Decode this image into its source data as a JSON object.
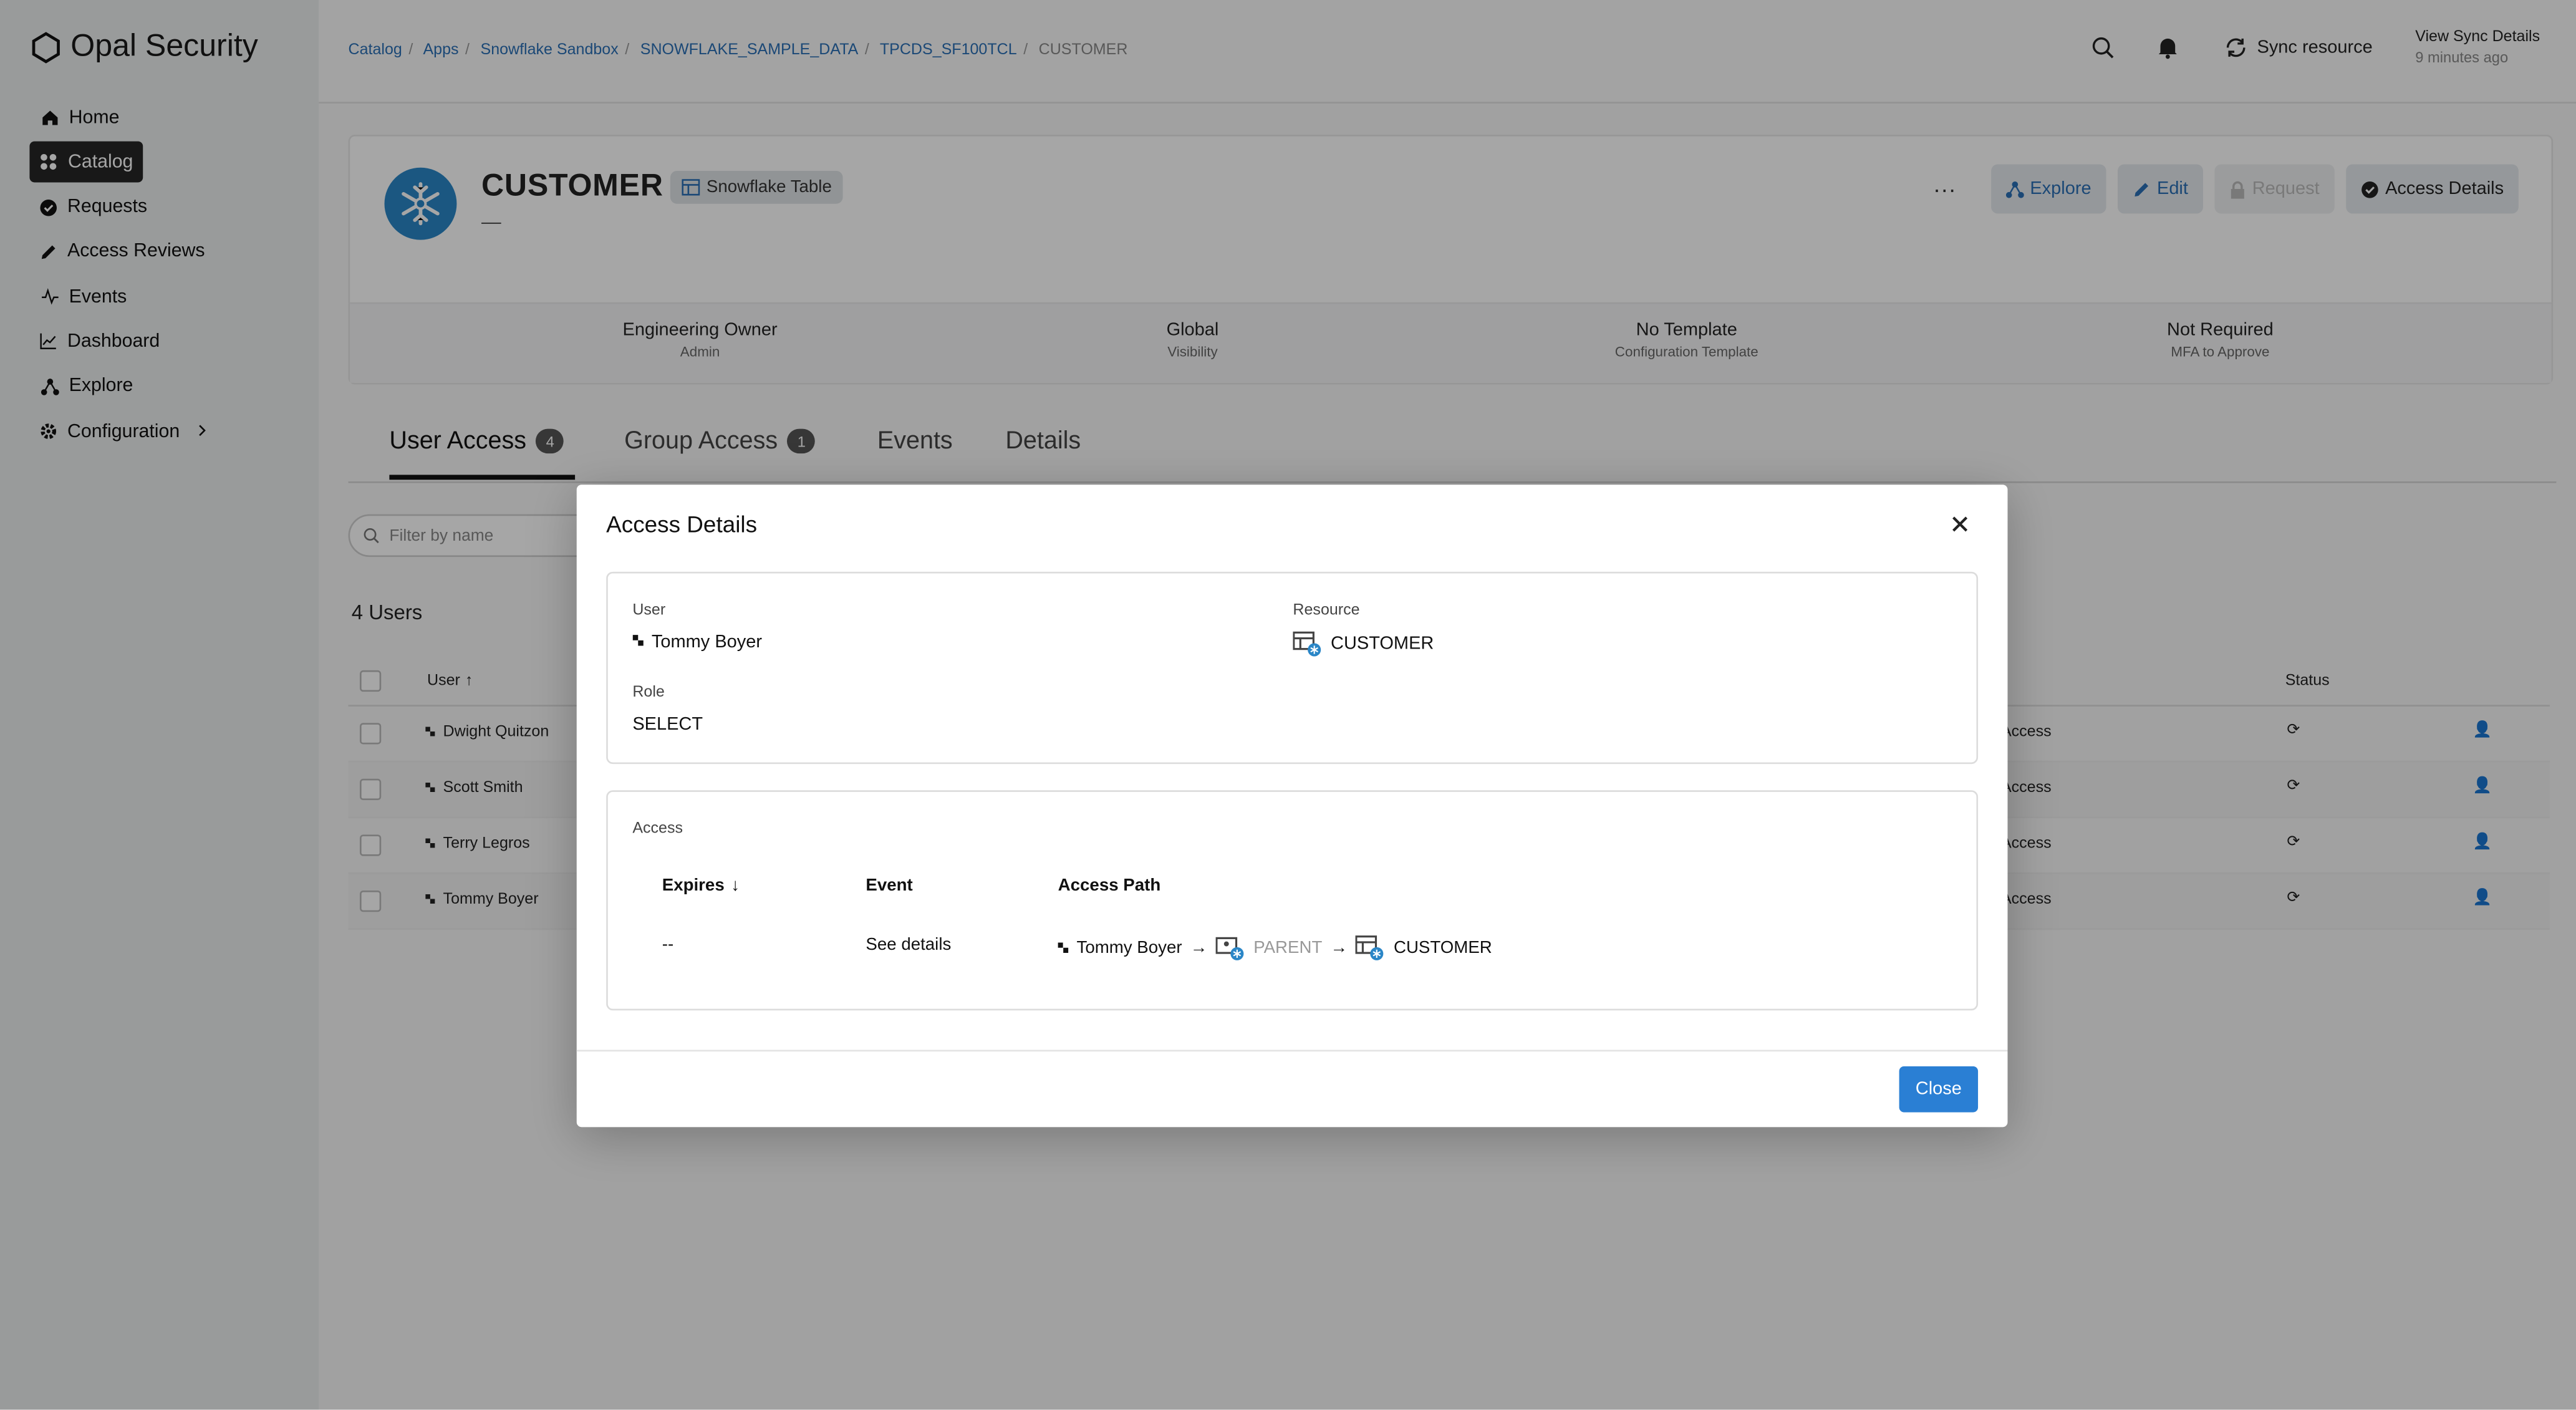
{
  "app": {
    "name": "Opal Security"
  },
  "sidebar": {
    "items": [
      {
        "label": "Home",
        "icon": "home-icon"
      },
      {
        "label": "Catalog",
        "icon": "grid-icon",
        "active": true
      },
      {
        "label": "Requests",
        "icon": "check-circle-icon"
      },
      {
        "label": "Access Reviews",
        "icon": "pencil-icon"
      },
      {
        "label": "Events",
        "icon": "activity-icon"
      },
      {
        "label": "Dashboard",
        "icon": "chart-icon"
      },
      {
        "label": "Explore",
        "icon": "graph-icon"
      },
      {
        "label": "Configuration",
        "icon": "gear-icon"
      }
    ]
  },
  "breadcrumb": [
    "Catalog",
    "Apps",
    "Snowflake Sandbox",
    "SNOWFLAKE_SAMPLE_DATA",
    "TPCDS_SF100TCL",
    "CUSTOMER"
  ],
  "topbar": {
    "sync_label": "Sync resource",
    "view_sync": "View Sync Details",
    "view_sync_time": "9 minutes ago"
  },
  "resource": {
    "title": "CUSTOMER",
    "type": "Snowflake Table",
    "description": "—",
    "actions": {
      "explore": "Explore",
      "edit": "Edit",
      "request": "Request",
      "access_details": "Access Details"
    },
    "meta": [
      {
        "value": "Engineering Owner",
        "label": "Admin"
      },
      {
        "value": "Global",
        "label": "Visibility"
      },
      {
        "value": "No Template",
        "label": "Configuration Template"
      },
      {
        "value": "Not Required",
        "label": "MFA to Approve"
      }
    ]
  },
  "tabs": [
    {
      "label": "User Access",
      "count": "4"
    },
    {
      "label": "Group Access",
      "count": "1"
    },
    {
      "label": "Events"
    },
    {
      "label": "Details"
    }
  ],
  "filter": {
    "placeholder": "Filter by name"
  },
  "users_count": "4 Users",
  "table": {
    "headers": {
      "user": "User",
      "status": "Status"
    },
    "rows": [
      {
        "name": "Dwight Quitzon",
        "access": "Access"
      },
      {
        "name": "Scott Smith",
        "access": "Access"
      },
      {
        "name": "Terry Legros",
        "access": "Access"
      },
      {
        "name": "Tommy Boyer",
        "access": "Access"
      }
    ]
  },
  "modal": {
    "title": "Access Details",
    "user_label": "User",
    "user_value": "Tommy Boyer",
    "resource_label": "Resource",
    "resource_value": "CUSTOMER",
    "role_label": "Role",
    "role_value": "SELECT",
    "access_label": "Access",
    "columns": {
      "expires": "Expires",
      "event": "Event",
      "path": "Access Path"
    },
    "row": {
      "expires": "--",
      "event": "See details",
      "path": [
        "Tommy Boyer",
        "PARENT",
        "CUSTOMER"
      ]
    },
    "close_label": "Close"
  },
  "colors": {
    "accent": "#2a7fd4",
    "link": "#2a6fb5",
    "sidebar_active": "#262626",
    "snowflake": "#2a86c7"
  }
}
